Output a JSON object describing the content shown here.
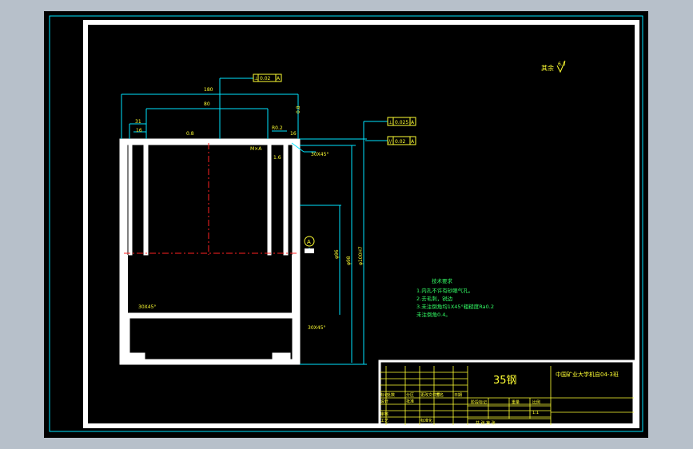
{
  "drawing": {
    "dimensions": {
      "overall_width": "180",
      "inner_width": "80",
      "left_wall": "31",
      "left_wall_sub": "16",
      "right_wall": "16",
      "height_right_outer": "φ100H7",
      "height_right_inner": "φ98",
      "height_mid": "φ96",
      "chamfer_top": "30X45°",
      "chamfer_side": "30X45°",
      "chamfer_bottom": "30X45°",
      "roughness_top": "0.8",
      "roughness_right": "0.8",
      "roughness_side": "1.6",
      "radius": "R0.2",
      "thread_label": "M×A"
    },
    "tolerance_frames": [
      {
        "symbol": "⊥",
        "value": "0.02",
        "datum": "A"
      },
      {
        "symbol": "⊥",
        "value": "0.025",
        "datum": "A"
      },
      {
        "symbol": "//",
        "value": "0.02",
        "datum": "A"
      }
    ],
    "datum_label": "A",
    "surface_finish": {
      "label": "其余",
      "value": "6.3"
    },
    "tech_requirements": {
      "title": "技术要求",
      "lines": [
        "1.内孔不许有砂眼气孔。",
        "2.去毛刺，锐边",
        "3.未注倒角均1X45°粗糙度Ra0.2",
        "  未注倒角0.4。"
      ]
    },
    "title_block": {
      "material": "35钢",
      "org": "中国矿业大学机自04-3班",
      "row_labels": [
        "标记",
        "处数",
        "分区",
        "更改文件号",
        "签名",
        "日期"
      ],
      "design_labels": [
        "设计",
        "审核",
        "工艺",
        "标准化",
        "批准"
      ],
      "stage_labels": [
        "阶段标记",
        "重量",
        "比例"
      ],
      "scale": "1:1",
      "sheet": "共  张  第  张"
    }
  }
}
